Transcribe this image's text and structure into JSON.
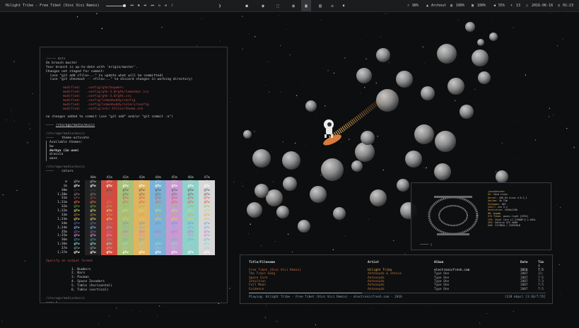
{
  "topbar": {
    "now_playing": "Hilight Tribe - Free Tibet (Vini Vici Remix)",
    "controls": [
      "⏮",
      "⏹",
      "⏯",
      "⏭",
      "↻",
      "⇄",
      "♪"
    ],
    "workspace_icons": [
      "❯",
      "●",
      "◉",
      "⬚",
      "◍",
      "▣",
      "▤",
      "◇",
      "◈",
      "♦",
      "❀"
    ],
    "status": {
      "battery": "98%",
      "location": "Archout",
      "cpu": "100%",
      "mem": "100%",
      "volume": "55%",
      "brightness": "13",
      "date": "2016-06-16",
      "time": "01:23"
    }
  },
  "git_terminal": {
    "prompt": "~~~~~ dots",
    "lines": [
      "On branch master",
      "Your branch is up-to-date with 'origin/master'.",
      "Changes not staged for commit:",
      "  (use \"git add <file>...\" to update what will be committed)",
      "  (use \"git checkout -- <file>...\" to discard changes in working directory)"
    ],
    "modified": [
      "modified:   .config/gtk/bspwmrc",
      "modified:   .config/gtk-3.0/gtk/lemonbar.ini",
      "modified:   .config/gtk-3.0/gtk.css",
      "modified:   .config/lemonbuddy/config",
      "modified:   .config/lemonbuddy/colors/config",
      "modified:   .config/zsh/.Xfiles/theme.zsh"
    ],
    "summary": "no changes added to commit (use \"git add\" and/or \"git commit -a\")",
    "dir_music": "/storage/media/music",
    "theme_prompt_dir": "/storage/media/music",
    "theme_cmd": "theme-activate",
    "themes_header": "Available themes:",
    "themes": [
      "bw",
      "dorkyx (in use)",
      "dracula",
      "wave"
    ],
    "colors_prompt_dir": "/storage/media/music",
    "colors_cmd": "colors",
    "color_headers": [
      "",
      "40m",
      "41m",
      "42m",
      "43m",
      "44m",
      "45m",
      "46m",
      "47m"
    ],
    "color_rows": [
      "m",
      "1m",
      "30m",
      "1;30m",
      "31m",
      "1;31m",
      "32m",
      "1;32m",
      "33m",
      "1;33m",
      "34m",
      "1;34m",
      "35m",
      "1;35m",
      "36m",
      "1;36m",
      "37m",
      "1;37m"
    ],
    "gYw": "gYw",
    "specify_prompt": "Specify an output format",
    "formats": [
      "1. Numbers",
      "2. Bars",
      "3. Pacman",
      "4. Space Invaders",
      "5. Table (horizontal)",
      "6. Table (vertical)"
    ],
    "last_prompt": "/storage/media/music"
  },
  "fetch": {
    "user_host": "jason@hermes",
    "info": [
      [
        "OS:",
        "Void Linux"
      ],
      [
        "Kernel:",
        "x86_64 Linux 4.6.2_1"
      ],
      [
        "Uptime:",
        "4h 13m"
      ],
      [
        "Packages:",
        "867"
      ],
      [
        "Shell:",
        "zsh 5.2"
      ],
      [
        "Resolution:",
        "1920x1200"
      ],
      [
        "WM:",
        "bspwm"
      ],
      [
        "GTK Theme:",
        "ponzi-light [GTK2]"
      ],
      [
        "CPU:",
        "Intel Core i7-2760QM @ 2.4GHz"
      ],
      [
        "GPU:",
        "GeForce GTX 560M"
      ],
      [
        "RAM:",
        "1173MiB / 15997MiB"
      ]
    ],
    "prompt": "~~~~~"
  },
  "player": {
    "headers": [
      "Title/Filename",
      "Artist",
      "Album",
      "Date",
      "Tim ?"
    ],
    "tracks": [
      [
        "Free Tibet (Vini Vici Remix)",
        "Hilight Tribe",
        "electronicfresh.com",
        "2016",
        "7:5"
      ],
      [
        "The Train Song",
        "Antonoydz & Iteica",
        "Type One",
        "2007",
        "11:"
      ],
      [
        "Space Core",
        "Antonoydz",
        "Type One",
        "2007",
        "7:5"
      ],
      [
        "Intuition",
        "Antonoydz",
        "Type One",
        "2007",
        "7:3"
      ],
      [
        "Full Moon",
        "Antonoydz",
        "Type One",
        "2007",
        "7:5"
      ],
      [
        "Evidence",
        "Antonoydz",
        "Type One",
        "2007",
        "7:5"
      ]
    ],
    "progress": 0.38,
    "status": "Playing: Hilight Tribe - Free Tibet (Vini Vici Remix) - electronicfresh.com - 2016",
    "time": "[128 kbps] [3:36/7:55]"
  },
  "colors": {
    "desktop_bg": "#0d0e10",
    "bar_bg": "#1b1c1e",
    "red": "#c0504d",
    "amber": "#d6a24c",
    "player_status": "#7fa8c4",
    "swatch_40m": "#222222",
    "swatch_41m": "#d24b3e",
    "swatch_42m": "#a7c07a",
    "swatch_43m": "#e0b460",
    "swatch_44m": "#7ab2d6",
    "swatch_45m": "#c79bd2",
    "swatch_46m": "#8fd0c8",
    "swatch_47m": "#d8d8d8"
  }
}
